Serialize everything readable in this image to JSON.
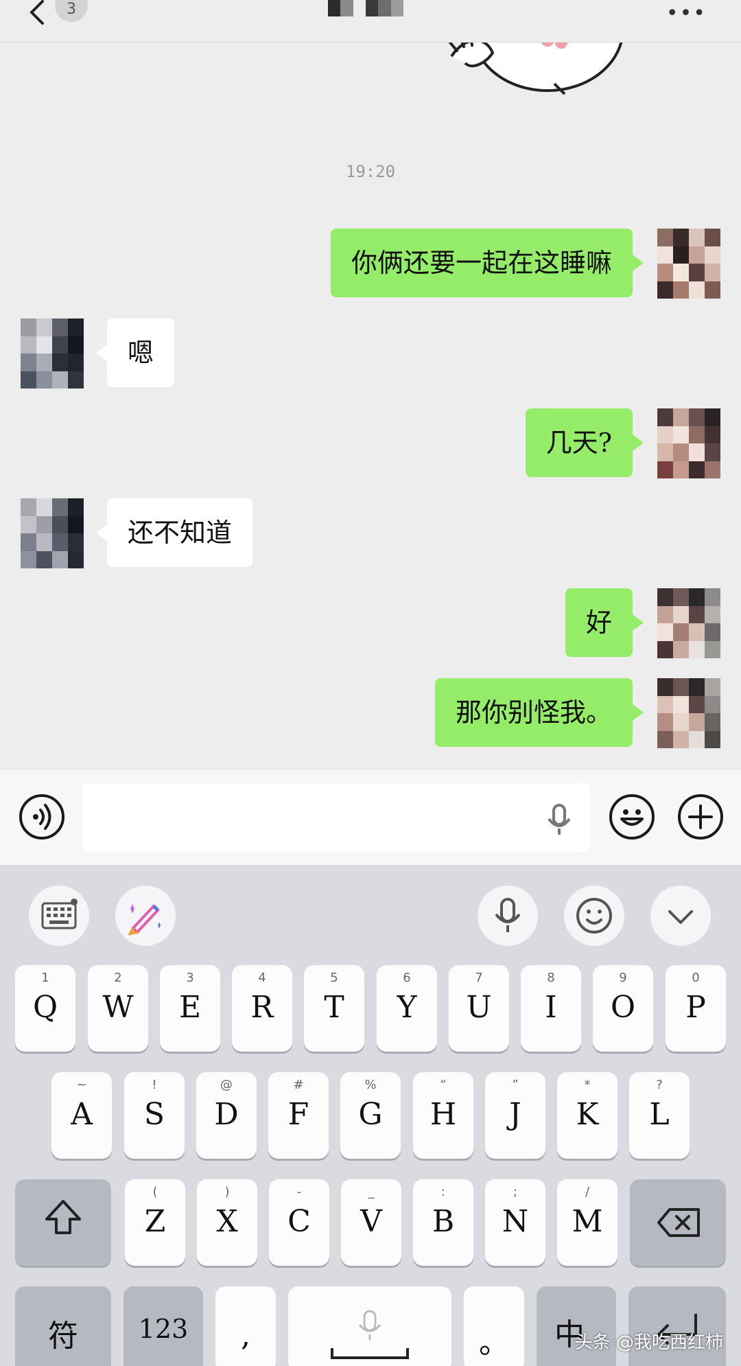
{
  "header": {
    "unread_badge": "3"
  },
  "chat": {
    "time": "19:20",
    "messages": [
      {
        "from": "me",
        "text": "你俩还要一起在这睡嘛"
      },
      {
        "from": "them",
        "text": "嗯"
      },
      {
        "from": "me",
        "text": "几天?"
      },
      {
        "from": "them",
        "text": "还不知道"
      },
      {
        "from": "me",
        "text": "好"
      },
      {
        "from": "me",
        "text": "那你别怪我。"
      }
    ]
  },
  "input": {
    "value": "",
    "placeholder": ""
  },
  "keyboard": {
    "row1": [
      {
        "top": "1",
        "main": "Q"
      },
      {
        "top": "2",
        "main": "W"
      },
      {
        "top": "3",
        "main": "E"
      },
      {
        "top": "4",
        "main": "R"
      },
      {
        "top": "5",
        "main": "T"
      },
      {
        "top": "6",
        "main": "Y"
      },
      {
        "top": "7",
        "main": "U"
      },
      {
        "top": "8",
        "main": "I"
      },
      {
        "top": "9",
        "main": "O"
      },
      {
        "top": "0",
        "main": "P"
      }
    ],
    "row2": [
      {
        "top": "~",
        "main": "A"
      },
      {
        "top": "!",
        "main": "S"
      },
      {
        "top": "@",
        "main": "D"
      },
      {
        "top": "#",
        "main": "F"
      },
      {
        "top": "%",
        "main": "G"
      },
      {
        "top": "“",
        "main": "H"
      },
      {
        "top": "”",
        "main": "J"
      },
      {
        "top": "*",
        "main": "K"
      },
      {
        "top": "?",
        "main": "L"
      }
    ],
    "row3": [
      {
        "top": "(",
        "main": "Z"
      },
      {
        "top": ")",
        "main": "X"
      },
      {
        "top": "-",
        "main": "C"
      },
      {
        "top": "_",
        "main": "V"
      },
      {
        "top": ":",
        "main": "B"
      },
      {
        "top": ";",
        "main": "N"
      },
      {
        "top": "/",
        "main": "M"
      }
    ],
    "symbols_label": "符",
    "numbers_label": "123",
    "comma_label": ",",
    "period_label": "。",
    "lang_label": "中"
  },
  "watermark": "头条 @我吃西红柿",
  "colors": {
    "my_bubble": "#95ec69",
    "their_bubble": "#ffffff",
    "chat_bg": "#ededed",
    "keyboard_bg": "#d9dbe0"
  }
}
